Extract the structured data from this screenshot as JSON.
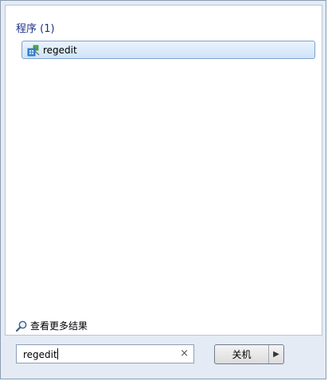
{
  "results": {
    "section_header": "程序 (1)",
    "items": [
      {
        "label": "regedit",
        "icon": "regedit-icon"
      }
    ]
  },
  "more_results": {
    "label": "查看更多结果",
    "icon": "magnifier-icon"
  },
  "search": {
    "value": "regedit",
    "clear_icon": "close-icon"
  },
  "shutdown": {
    "label": "关机",
    "arrow_icon": "chevron-right-icon"
  }
}
